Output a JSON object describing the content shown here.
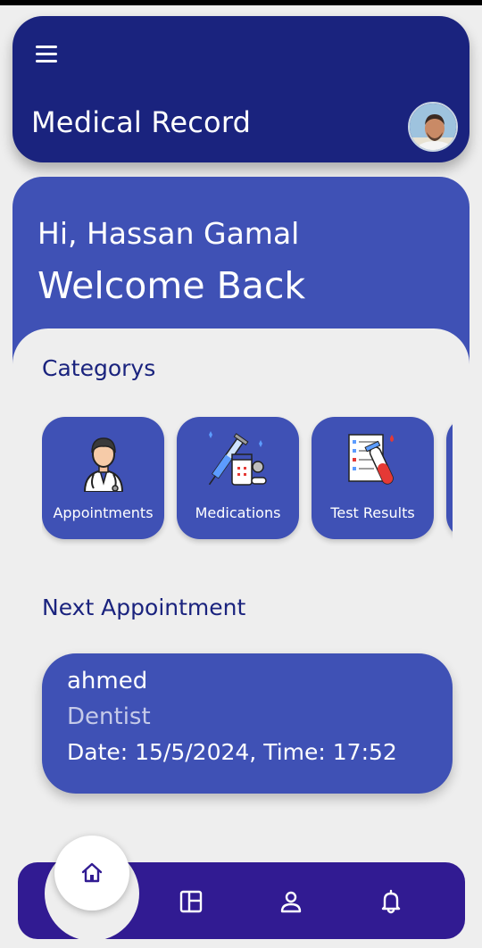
{
  "app_bar": {
    "title": "Medical Record",
    "menu_icon": "hamburger-menu-icon",
    "avatar_icon": "user-avatar"
  },
  "welcome": {
    "greeting": "Hi, Hassan Gamal",
    "message": "Welcome Back"
  },
  "categories": {
    "title": "Categorys",
    "items": [
      {
        "label": "Appointments",
        "icon": "doctor-icon"
      },
      {
        "label": "Medications",
        "icon": "medicine-icon"
      },
      {
        "label": "Test Results",
        "icon": "test-results-icon"
      }
    ]
  },
  "next_appointment": {
    "title": "Next Appointment",
    "doctor": "ahmed",
    "specialty": "Dentist",
    "datetime": "Date: 15/5/2024, Time: 17:52"
  },
  "bottom_nav": {
    "items": [
      "home-icon",
      "dashboard-icon",
      "profile-icon",
      "notification-bell-icon"
    ],
    "active": "home-icon"
  },
  "colors": {
    "primary_dark": "#1a237e",
    "primary": "#3f51b5",
    "nav": "#311b92",
    "background": "#eeeeee"
  }
}
